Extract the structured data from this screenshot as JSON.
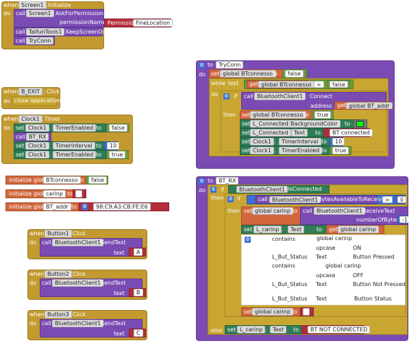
{
  "kw": {
    "when": "when",
    "do": "do",
    "call": "call",
    "set": "set",
    "to": "to",
    "if": "if",
    "then": "then",
    "else": "else",
    "while": "while",
    "test": "test",
    "get": "get",
    "initialize_global": "initialize global",
    "text": "text",
    "address": "address",
    "number_of_bytes": "numberOfBytes",
    "permission_name": "permissionName",
    "permission": "Permission",
    "not": "not",
    "eq": "=",
    "gt": ">",
    "dot": "."
  },
  "screen_init": {
    "component": "Screen1",
    "event": "Initialize",
    "ask_comp": "Screen1",
    "ask_method": "AskForPermission",
    "perm_value": "FineLocation",
    "taifun_comp": "TaifunTools1",
    "taifun_method": "KeepScreenOn",
    "proc_call": "TryConn"
  },
  "b_exit": {
    "component": "B_EXIT",
    "event": "Click",
    "action": "close application"
  },
  "clock": {
    "component": "Clock1",
    "event": "Timer",
    "prop1": "TimerEnabled",
    "val1": "false",
    "proc": "BT_RX",
    "prop2": "TimerInterval",
    "val2": "10",
    "prop3": "TimerEnabled",
    "val3": "true"
  },
  "globals": [
    {
      "name": "BTconnesso",
      "value": "false"
    },
    {
      "name": "carinp",
      "value": ""
    },
    {
      "name": "BT_addr",
      "value": "98:C9:A3:CB:FE:E6"
    }
  ],
  "buttons": [
    {
      "component": "Button1",
      "event": "Click",
      "bt": "BluetoothClient1",
      "method": "SendText",
      "value": "A"
    },
    {
      "component": "Button2",
      "event": "Click",
      "bt": "BluetoothClient1",
      "method": "SendText",
      "value": "B"
    },
    {
      "component": "Button3",
      "event": "Click",
      "bt": "BluetoothClient1",
      "method": "SendText",
      "value": "C"
    }
  ],
  "tryconn": {
    "name": "TryConn",
    "var": "global BTconnesso",
    "false": "false",
    "bt": "BluetoothClient1",
    "method": "Connect",
    "addr_var": "global BT_addr",
    "true": "true",
    "lbl": "L_Connected",
    "prop_bg": "BackgroundColor",
    "prop_text": "Text",
    "connected_text": "BT connected",
    "clock": "Clock1",
    "prop_interval": "TimerInterval",
    "interval_value": "10",
    "prop_enabled": "TimerEnabled"
  },
  "btrx": {
    "name": "BT_RX",
    "bt": "BluetoothClient1",
    "is_connected": "IsConnected",
    "bytes": "BytesAvailableToReceive",
    "zero": "0",
    "carinp": "global carinp",
    "receive": "ReceiveText",
    "minus_one": "-1",
    "lcarinp": "L_carinp",
    "text_prop": "Text",
    "contains": "contains",
    "upcase": "upcase",
    "on": "ON",
    "off": "OFF",
    "status": "L_But_Status",
    "pressed": "Button Pressed",
    "not_pressed": "Button Not Pressed",
    "btn_status": "Button Status",
    "empty": "",
    "not_connected": "BT NOT CONNECTED"
  }
}
